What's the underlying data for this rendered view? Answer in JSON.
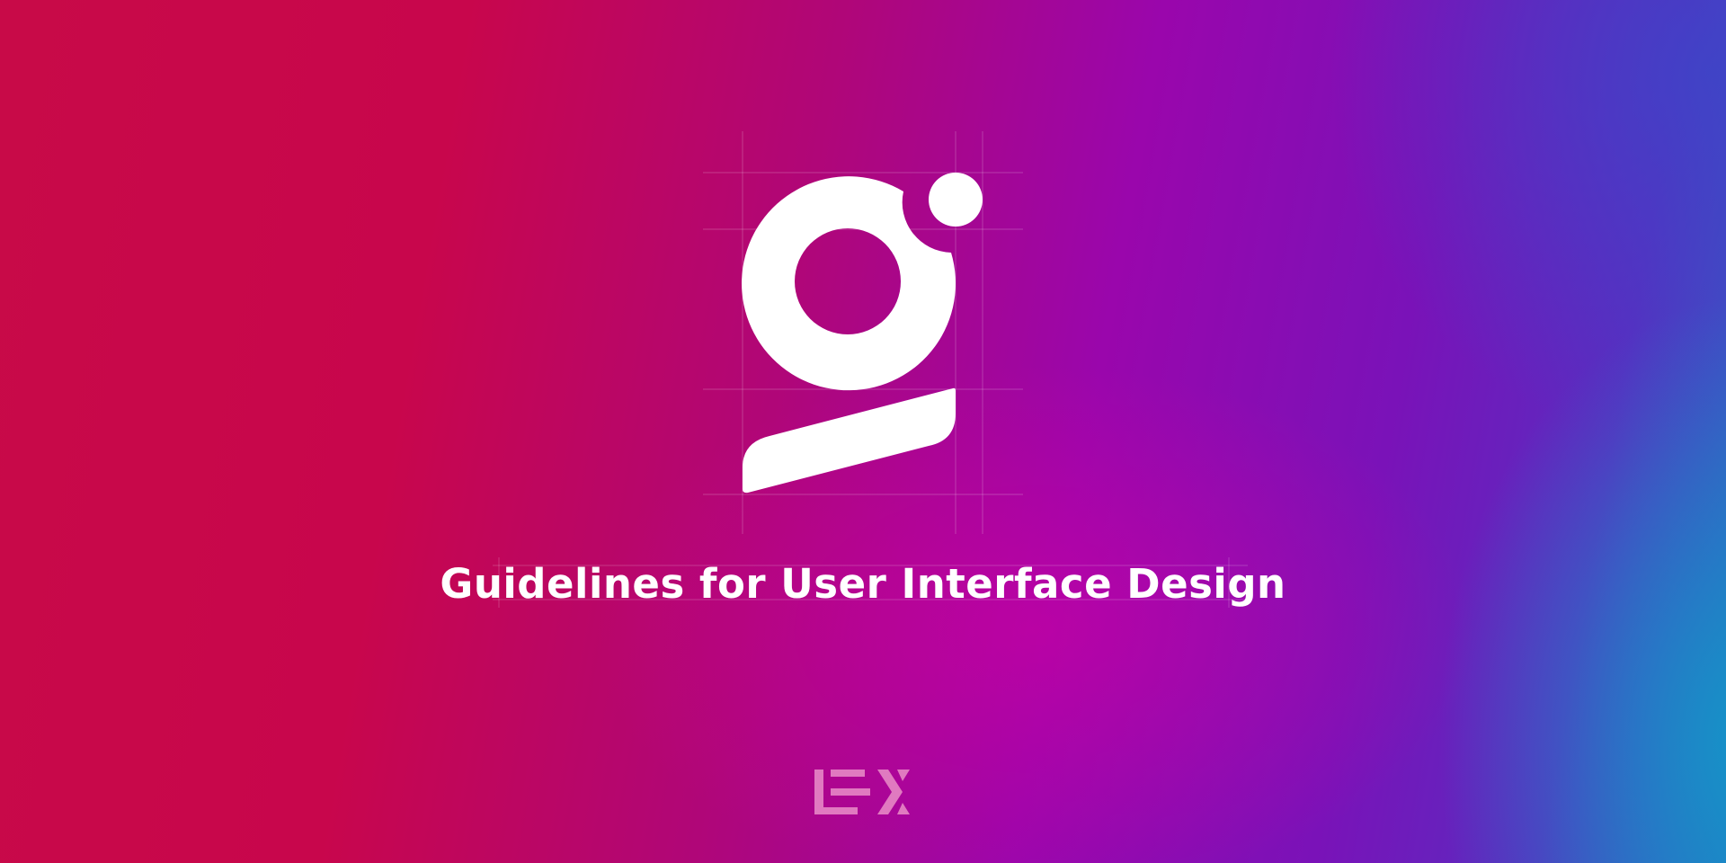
{
  "title": "Guidelines for User Interface Design",
  "logo": {
    "icon": "g-logomark-icon",
    "color": "#ffffff",
    "guide_color": "rgba(255,255,255,0.22)"
  },
  "footer_logo": {
    "icon": "lex-wordmark-icon",
    "color": "#e07ac0"
  },
  "background": {
    "colors": [
      "#c80a48",
      "#b00678",
      "#9a06ac",
      "#7a12b8",
      "#2a6cc4"
    ]
  }
}
